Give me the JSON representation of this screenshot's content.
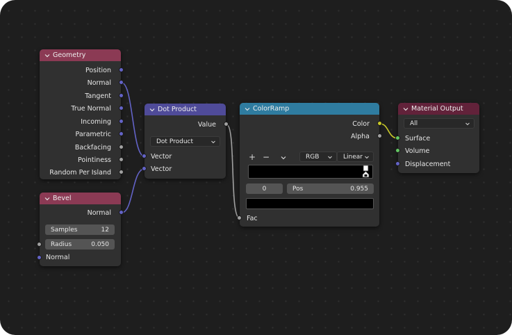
{
  "colors": {
    "vector_socket": "#6363c7",
    "float_socket": "#a1a1a1",
    "color_socket": "#c7c729",
    "shader_socket": "#63c763",
    "input_header": "#8b3a54",
    "converter_header": "#4f4b99",
    "ramp_header": "#2f7ca0",
    "output_header": "#62223a"
  },
  "geometry": {
    "title": "Geometry",
    "outputs": [
      "Position",
      "Normal",
      "Tangent",
      "True Normal",
      "Incoming",
      "Parametric",
      "Backfacing",
      "Pointiness",
      "Random Per Island"
    ]
  },
  "bevel": {
    "title": "Bevel",
    "output_normal": "Normal",
    "samples_label": "Samples",
    "samples_value": "12",
    "radius_label": "Radius",
    "radius_value": "0.050",
    "input_normal": "Normal"
  },
  "dot_product": {
    "title": "Dot Product",
    "output_value": "Value",
    "operation": "Dot Product",
    "input_vector_1": "Vector",
    "input_vector_2": "Vector"
  },
  "color_ramp": {
    "title": "ColorRamp",
    "output_color": "Color",
    "output_alpha": "Alpha",
    "add_label": "+",
    "remove_label": "−",
    "color_mode": "RGB",
    "interpolation": "Linear",
    "stop_index": "0",
    "pos_label": "Pos",
    "pos_value": "0.955",
    "input_fac": "Fac"
  },
  "material_output": {
    "title": "Material Output",
    "target": "All",
    "input_surface": "Surface",
    "input_volume": "Volume",
    "input_displacement": "Displacement"
  }
}
